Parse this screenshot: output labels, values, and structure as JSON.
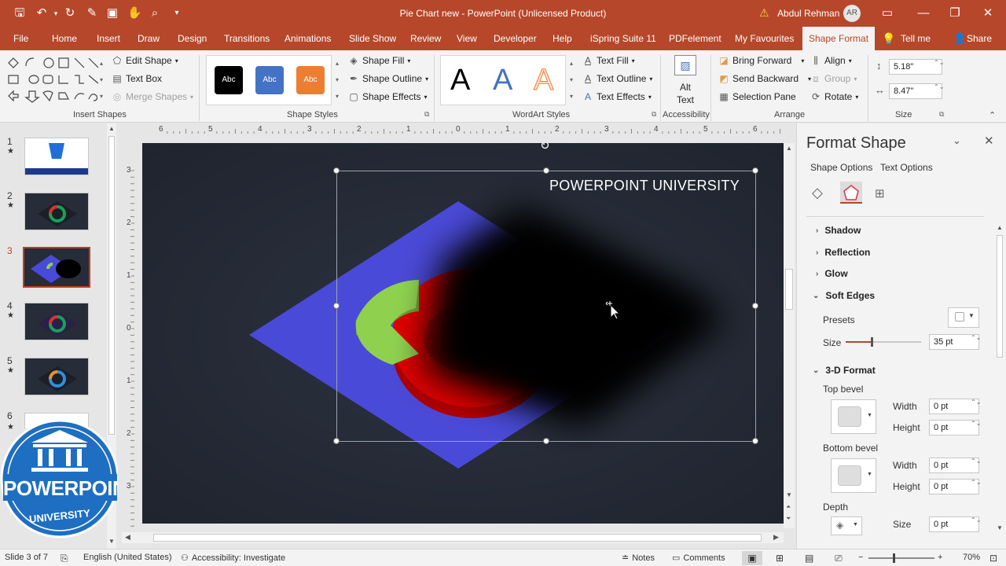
{
  "window": {
    "title": "Pie Chart new  -  PowerPoint (Unlicensed Product)",
    "user_name": "Abdul Rehman",
    "user_initials": "AR"
  },
  "tabs": [
    {
      "label": "File"
    },
    {
      "label": "Home"
    },
    {
      "label": "Insert"
    },
    {
      "label": "Draw"
    },
    {
      "label": "Design"
    },
    {
      "label": "Transitions"
    },
    {
      "label": "Animations"
    },
    {
      "label": "Slide Show"
    },
    {
      "label": "Review"
    },
    {
      "label": "View"
    },
    {
      "label": "Developer"
    },
    {
      "label": "Help"
    },
    {
      "label": "iSpring Suite 11"
    },
    {
      "label": "PDFelement"
    },
    {
      "label": "My Favourites"
    },
    {
      "label": "Shape Format"
    },
    {
      "label": "Tell me"
    },
    {
      "label": "Share"
    }
  ],
  "ribbon": {
    "insert_shapes": {
      "label": "Insert Shapes",
      "edit_shape": "Edit Shape",
      "text_box": "Text Box",
      "merge_shapes": "Merge Shapes"
    },
    "shape_styles": {
      "label": "Shape Styles",
      "sample": "Abc",
      "shape_fill": "Shape Fill",
      "shape_outline": "Shape Outline",
      "shape_effects": "Shape Effects"
    },
    "wordart_styles": {
      "label": "WordArt Styles",
      "sample": "A",
      "text_fill": "Text Fill",
      "text_outline": "Text Outline",
      "text_effects": "Text Effects"
    },
    "accessibility": {
      "label": "Accessibility",
      "alt_text_line1": "Alt",
      "alt_text_line2": "Text"
    },
    "arrange": {
      "label": "Arrange",
      "bring_forward": "Bring Forward",
      "send_backward": "Send Backward",
      "selection_pane": "Selection Pane",
      "align": "Align",
      "group": "Group",
      "rotate": "Rotate"
    },
    "size": {
      "label": "Size",
      "height": "5.18\"",
      "width": "8.47\""
    }
  },
  "ruler_labels": [
    "6",
    "5",
    "4",
    "3",
    "2",
    "1",
    "0",
    "1",
    "2",
    "3",
    "4",
    "5",
    "6"
  ],
  "vruler_labels": [
    "3",
    "2",
    "1",
    "0",
    "1",
    "2",
    "3"
  ],
  "slides": [
    {
      "num": "1",
      "starred": "★"
    },
    {
      "num": "2",
      "starred": "★"
    },
    {
      "num": "3",
      "starred": ""
    },
    {
      "num": "4",
      "starred": "★"
    },
    {
      "num": "5",
      "starred": "★"
    },
    {
      "num": "6",
      "starred": "★"
    }
  ],
  "slide_text": "POWERPOINT UNIVERSITY",
  "logo": {
    "line1": "POWERPOINT",
    "line2": "UNIVERSITY"
  },
  "format_pane": {
    "title": "Format Shape",
    "tab_shape_options": "Shape Options",
    "tab_text_options": "Text Options",
    "sections": {
      "shadow": "Shadow",
      "reflection": "Reflection",
      "glow": "Glow",
      "soft_edges": "Soft Edges",
      "three_d_format": "3-D Format"
    },
    "presets_label": "Presets",
    "size_label": "Size",
    "soft_edge_size": "35 pt",
    "top_bevel": "Top bevel",
    "bottom_bevel": "Bottom bevel",
    "width_label": "Width",
    "height_label": "Height",
    "top_width": "0 pt",
    "top_height": "0 pt",
    "bottom_width": "0 pt",
    "bottom_height": "0 pt",
    "depth_label": "Depth",
    "depth_size_label": "Size",
    "depth_size": "0 pt"
  },
  "statusbar": {
    "slide_info": "Slide 3 of 7",
    "language": "English (United States)",
    "accessibility": "Accessibility: Investigate",
    "notes": "Notes",
    "comments": "Comments",
    "zoom": "70%"
  },
  "colors": {
    "accent": "#b7472a",
    "slide_bg": "#262c38",
    "diamond": "#4a4ad8",
    "ring_red": "#e00000",
    "ring_green": "#8fd14f"
  }
}
